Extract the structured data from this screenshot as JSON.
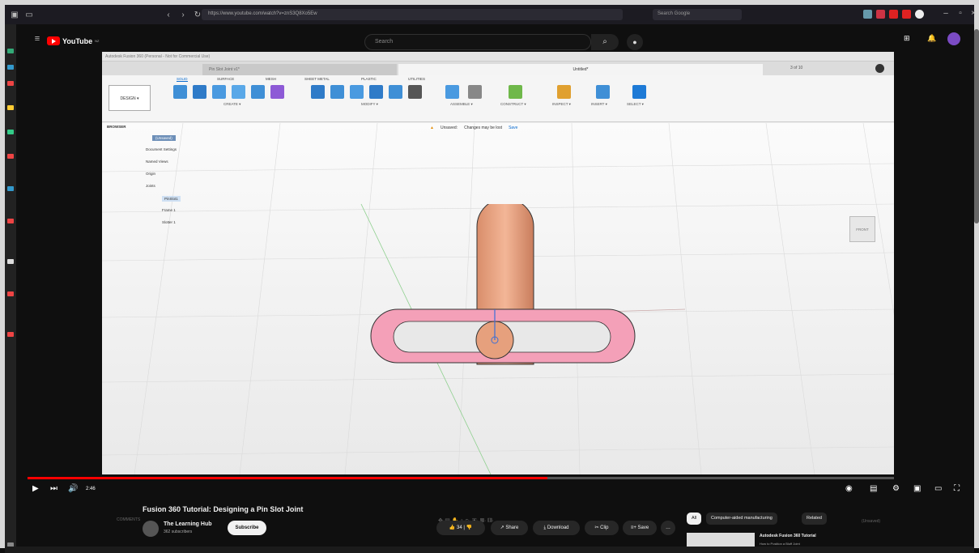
{
  "browser": {
    "url": "https://www.youtube.com/watch?v=znS3Q8Xo5Ew",
    "search_placeholder": "Search Google"
  },
  "youtube": {
    "logo": "YouTube",
    "logo_region": "NZ",
    "search_placeholder": "Search"
  },
  "fusion": {
    "window_title": "Autodesk Fusion 360 (Personal - Not for Commercial Use)",
    "tab_inactive": "Pin Slot Joint v1*",
    "tab_active": "Untitled*",
    "tab_counter": "3 of 10",
    "design_button": "DESIGN ▾",
    "ribbon_tabs": [
      "SOLID",
      "SURFACE",
      "MESH",
      "SHEET METAL",
      "PLASTIC",
      "UTILITIES"
    ],
    "ribbon_groups": [
      "CREATE ▾",
      "MODIFY ▾",
      "ASSEMBLE ▾",
      "CONSTRUCT ▾",
      "INSPECT ▾",
      "INSERT ▾",
      "SELECT ▾"
    ],
    "browser_label": "BROWSER",
    "tree": [
      {
        "label": "(Unsaved)"
      },
      {
        "label": "Document Settings"
      },
      {
        "label": "Named Views"
      },
      {
        "label": "Origin"
      },
      {
        "label": "Joints"
      },
      {
        "label": "PinSlot1"
      },
      {
        "label": "Frame 1"
      },
      {
        "label": "Slotter 1"
      }
    ],
    "warning_label": "Unsaved:",
    "warning_text": "Changes may be lost",
    "save_label": "Save",
    "viewcube_label": "FRONT",
    "comments_label": "COMMENTS",
    "unsaved_status": "(Unsaved)"
  },
  "video": {
    "title": "Fusion 360 Tutorial: Designing a Pin Slot Joint",
    "channel": "The Learning Hub",
    "subscribers": "362 subscribers",
    "subscribe": "Subscribe",
    "likes": "34",
    "share": "Share",
    "download": "Download",
    "clip": "Clip",
    "save": "Save",
    "time": "2:46"
  },
  "chips": [
    "All",
    "Computer-aided manufacturing",
    "Related"
  ],
  "recommendation": {
    "title": "Autodesk Fusion 360 Tutorial",
    "subtitle": "How to Position a Bluff Joint"
  },
  "colors": {
    "pin": "#e6a07d",
    "slot": "#f4a0b8",
    "accent": "#0a6bcf",
    "yt_red": "#ff0000"
  }
}
